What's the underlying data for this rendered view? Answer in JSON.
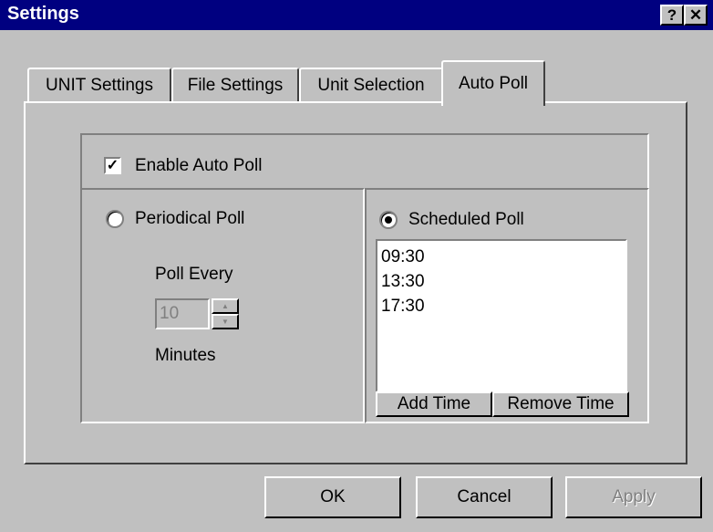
{
  "window": {
    "title": "Settings",
    "help_button": "?",
    "close_button": "✕"
  },
  "tabs": [
    {
      "label": "UNIT Settings",
      "active": false
    },
    {
      "label": "File Settings",
      "active": false
    },
    {
      "label": "Unit Selection",
      "active": false
    },
    {
      "label": "Auto Poll",
      "active": true
    }
  ],
  "auto_poll": {
    "enable_label": "Enable Auto Poll",
    "enabled": true,
    "periodical": {
      "label": "Periodical Poll",
      "selected": false,
      "poll_every_label": "Poll Every",
      "interval_value": "10",
      "minutes_label": "Minutes"
    },
    "scheduled": {
      "label": "Scheduled Poll",
      "selected": true,
      "times": [
        "09:30",
        "13:30",
        "17:30"
      ],
      "add_time_label": "Add Time",
      "remove_time_label": "Remove Time"
    }
  },
  "footer": {
    "ok_label": "OK",
    "cancel_label": "Cancel",
    "apply_label": "Apply"
  }
}
